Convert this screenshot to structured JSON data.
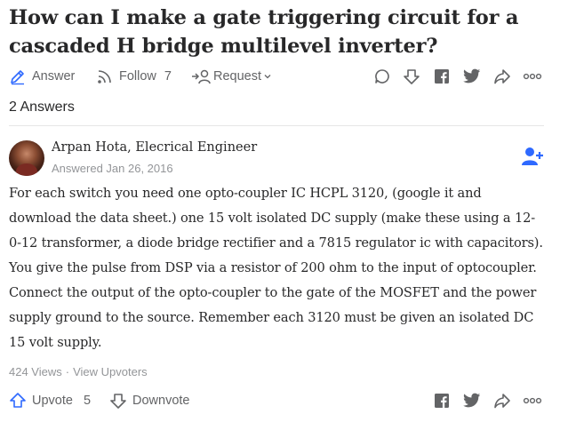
{
  "question": {
    "title": "How can I make a gate triggering circuit for a cascaded H bridge multilevel inverter?"
  },
  "question_actions": {
    "answer_label": "Answer",
    "follow_label": "Follow",
    "follow_count": "7",
    "request_label": "Request",
    "icons": [
      "pencil-icon",
      "follow-icon",
      "request-icon",
      "chevron-down-icon",
      "comment-icon",
      "downvote-icon",
      "facebook-icon",
      "twitter-icon",
      "share-icon",
      "more-icon"
    ]
  },
  "answers_count": "2 Answers",
  "answer": {
    "author_name": "Arpan Hota, Elecrical Engineer",
    "answered_date": "Answered Jan 26, 2016",
    "text": "For each switch you need one opto-coupler IC HCPL 3120, (google it and download the data sheet.) one 15 volt isolated DC supply (make these using a 12-0-12 transformer, a diode bridge rectifier and a 7815 regulator ic with capacitors). You give the pulse from DSP via a resistor of 200 ohm to the input of optocoupler. Connect the output of the opto-coupler to the gate of the MOSFET and the power supply ground to the source. Remember each 3120 must be given an isolated DC 15 volt supply.",
    "views": "424 Views",
    "separator": "·",
    "view_upvoters": "View Upvoters"
  },
  "answer_actions": {
    "upvote_label": "Upvote",
    "upvote_count": "5",
    "downvote_label": "Downvote",
    "icons": [
      "upvote-icon",
      "downvote-icon",
      "facebook-icon",
      "twitter-icon",
      "share-icon",
      "more-icon"
    ]
  },
  "colors": {
    "text_primary": "#282829",
    "text_secondary": "#636466",
    "text_muted": "#939598",
    "accent_blue": "#2e69ff",
    "icon_gray": "#636466"
  }
}
